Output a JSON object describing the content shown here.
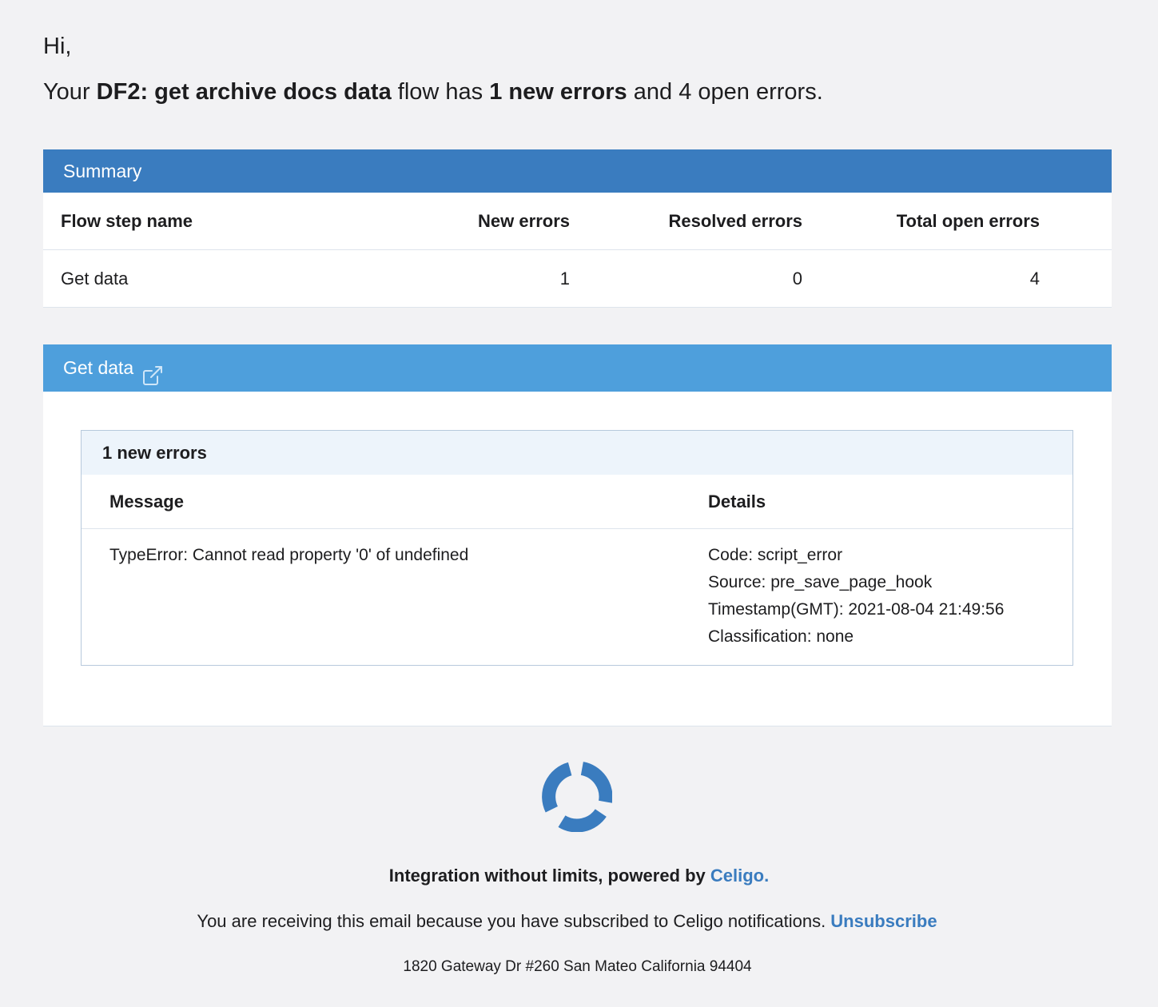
{
  "greeting": "Hi,",
  "intro": {
    "prefix": "Your ",
    "flow_name": "DF2: get archive docs data",
    "middle": " flow has ",
    "new_errors": "1 new errors",
    "suffix": " and 4 open errors."
  },
  "summary": {
    "title": "Summary",
    "columns": {
      "name": "Flow step name",
      "new": "New errors",
      "resolved": "Resolved errors",
      "total": "Total open errors"
    },
    "rows": [
      {
        "name": "Get data",
        "new": "1",
        "resolved": "0",
        "total": "4"
      }
    ]
  },
  "step": {
    "title": "Get data",
    "icon": "external-link-icon",
    "errors_title": "1 new errors",
    "columns": {
      "message": "Message",
      "details": "Details"
    },
    "errors": [
      {
        "message": "TypeError: Cannot read property '0' of undefined",
        "code": "Code: script_error",
        "source": "Source: pre_save_page_hook",
        "timestamp": "Timestamp(GMT): 2021-08-04 21:49:56",
        "classification": "Classification: none"
      }
    ]
  },
  "footer": {
    "logo_icon": "celigo-logo-icon",
    "tagline": "Integration without limits, powered by ",
    "brand_link": "Celigo.",
    "notice": "You are receiving this email because you have subscribed to Celigo notifications. ",
    "unsubscribe": "Unsubscribe",
    "address": "1820 Gateway Dr #260 San Mateo California 94404"
  },
  "colors": {
    "summary_header": "#3a7cbf",
    "step_header": "#4e9fdc",
    "link": "#3a7cbf",
    "background": "#f2f2f4"
  }
}
